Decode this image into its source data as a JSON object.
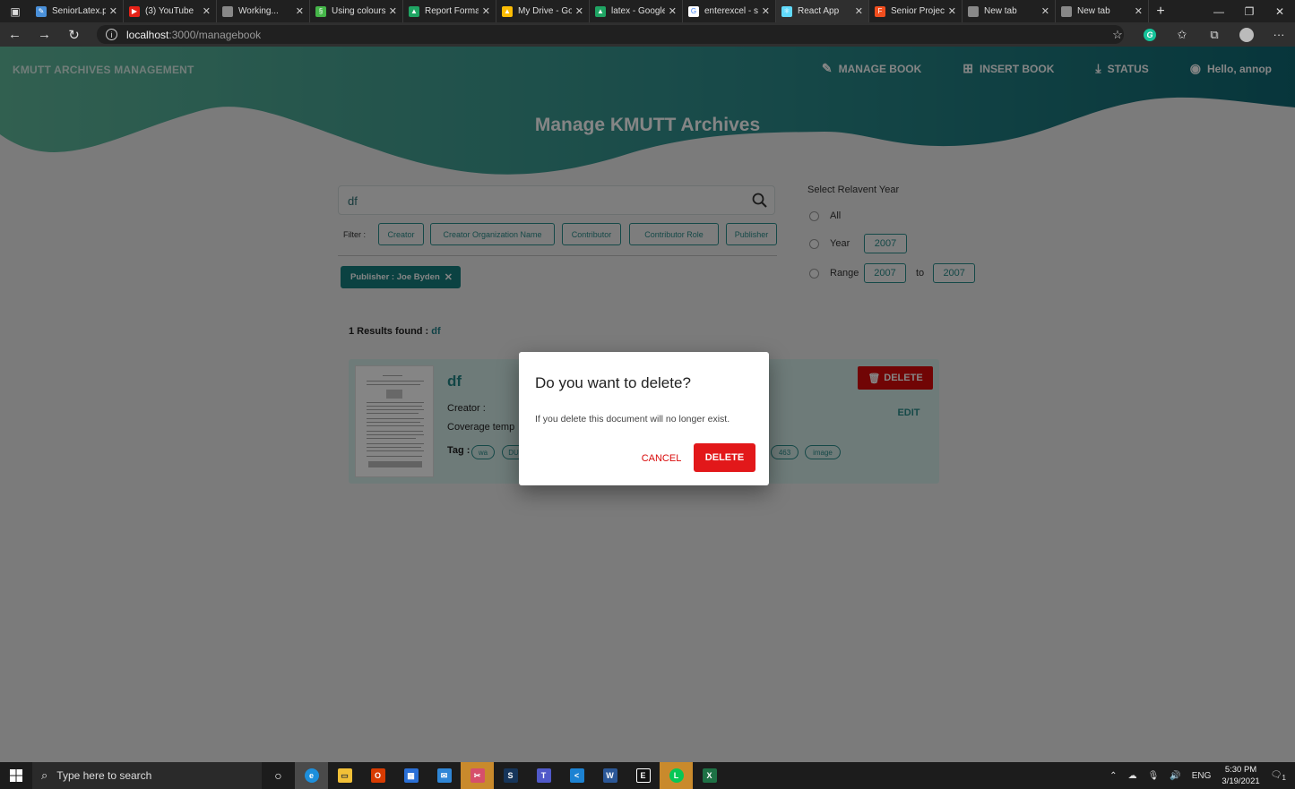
{
  "browser": {
    "tabs": [
      {
        "title": "SeniorLatex.p",
        "fav": "#4a90d9",
        "glyph": "✎"
      },
      {
        "title": "(3) YouTube",
        "fav": "#e62117",
        "glyph": "▶"
      },
      {
        "title": "Working...",
        "fav": "#888888",
        "glyph": ""
      },
      {
        "title": "Using colours",
        "fav": "#45b649",
        "glyph": "§"
      },
      {
        "title": "Report Forma",
        "fav": "#1fa463",
        "glyph": "▲"
      },
      {
        "title": "My Drive - Go",
        "fav": "#fbbc04",
        "glyph": "▲"
      },
      {
        "title": "latex - Google",
        "fav": "#1fa463",
        "glyph": "▲"
      },
      {
        "title": "enterexcel - s",
        "fav": "#ffffff",
        "glyph": "G"
      },
      {
        "title": "React App",
        "fav": "#61dafb",
        "glyph": "⚛"
      },
      {
        "title": "Senior Projec",
        "fav": "#f24e1e",
        "glyph": "F"
      },
      {
        "title": "New tab",
        "fav": "#888888",
        "glyph": ""
      },
      {
        "title": "New tab",
        "fav": "#888888",
        "glyph": ""
      }
    ],
    "url_host": "localhost",
    "url_path": ":3000/managebook"
  },
  "app": {
    "brand": "KMUTT ARCHIVES MANAGEMENT",
    "nav": {
      "manage": "MANAGE BOOK",
      "insert": "INSERT BOOK",
      "status": "STATUS",
      "user": "Hello, annop"
    },
    "heading": "Manage KMUTT Archives",
    "colors": {
      "teal": "#2a8c8a",
      "accent_red": "#d90b0b"
    }
  },
  "search": {
    "value": "df",
    "filter_label": "Filter :",
    "filters": [
      "Creator",
      "Creator Organization Name",
      "Contributor",
      "Contributor Role",
      "Publisher"
    ],
    "applied_filter": "Publisher : Joe Byden"
  },
  "year": {
    "title": "Select Relavent Year",
    "all_label": "All",
    "year_label": "Year",
    "year_value": "2007",
    "range_label": "Range",
    "range_from": "2007",
    "range_to_label": "to",
    "range_to": "2007"
  },
  "results": {
    "count_text": "1 Results found :",
    "query": "df",
    "card": {
      "title": "df",
      "creator_label": "Creator :",
      "coverage_label": "Coverage temp",
      "tag_label": "Tag :",
      "tags_left": [
        "wa",
        "DU"
      ],
      "tags_right": [
        "463",
        "image"
      ],
      "delete_label": "DELETE",
      "edit_label": "EDIT"
    }
  },
  "dialog": {
    "title": "Do you want to delete?",
    "message": "If you delete this document will no longer exist.",
    "cancel_label": "CANCEL",
    "delete_label": "DELETE"
  },
  "taskbar": {
    "search_placeholder": "Type here to search",
    "lang": "ENG",
    "time": "5:30 PM",
    "date": "3/19/2021",
    "notification_count": "1"
  }
}
